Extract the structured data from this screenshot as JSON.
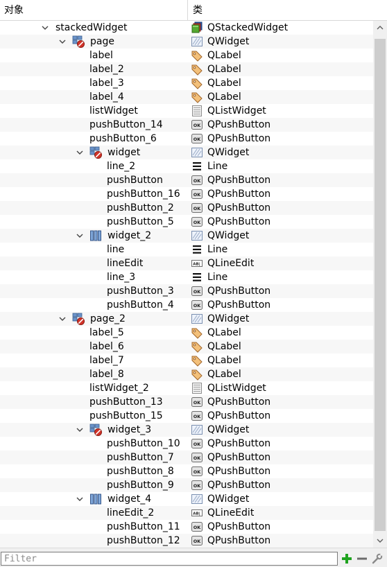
{
  "header": {
    "col_object": "对象",
    "col_class": "类"
  },
  "filter": {
    "placeholder": "Filter",
    "value": ""
  },
  "rows": [
    {
      "name": "stackedWidget",
      "cls": "QStackedWidget",
      "depth": 0,
      "expanded": true,
      "nicon": "none",
      "cicon": "stacked-widget"
    },
    {
      "name": "page",
      "cls": "QWidget",
      "depth": 1,
      "expanded": true,
      "nicon": "grid-layout-broken",
      "cicon": "widget"
    },
    {
      "name": "label",
      "cls": "QLabel",
      "depth": 2,
      "nicon": "none",
      "cicon": "label"
    },
    {
      "name": "label_2",
      "cls": "QLabel",
      "depth": 2,
      "nicon": "none",
      "cicon": "label"
    },
    {
      "name": "label_3",
      "cls": "QLabel",
      "depth": 2,
      "nicon": "none",
      "cicon": "label"
    },
    {
      "name": "label_4",
      "cls": "QLabel",
      "depth": 2,
      "nicon": "none",
      "cicon": "label"
    },
    {
      "name": "listWidget",
      "cls": "QListWidget",
      "depth": 2,
      "nicon": "none",
      "cicon": "list-widget"
    },
    {
      "name": "pushButton_14",
      "cls": "QPushButton",
      "depth": 2,
      "nicon": "none",
      "cicon": "push-button"
    },
    {
      "name": "pushButton_6",
      "cls": "QPushButton",
      "depth": 2,
      "nicon": "none",
      "cicon": "push-button"
    },
    {
      "name": "widget",
      "cls": "QWidget",
      "depth": 2,
      "expanded": true,
      "nicon": "grid-layout-broken",
      "cicon": "widget"
    },
    {
      "name": "line_2",
      "cls": "Line",
      "depth": 3,
      "nicon": "none",
      "cicon": "line"
    },
    {
      "name": "pushButton",
      "cls": "QPushButton",
      "depth": 3,
      "nicon": "none",
      "cicon": "push-button"
    },
    {
      "name": "pushButton_16",
      "cls": "QPushButton",
      "depth": 3,
      "nicon": "none",
      "cicon": "push-button"
    },
    {
      "name": "pushButton_2",
      "cls": "QPushButton",
      "depth": 3,
      "nicon": "none",
      "cicon": "push-button"
    },
    {
      "name": "pushButton_5",
      "cls": "QPushButton",
      "depth": 3,
      "nicon": "none",
      "cicon": "push-button"
    },
    {
      "name": "widget_2",
      "cls": "QWidget",
      "depth": 2,
      "expanded": true,
      "nicon": "horizontal-layout",
      "cicon": "widget"
    },
    {
      "name": "line",
      "cls": "Line",
      "depth": 3,
      "nicon": "none",
      "cicon": "line"
    },
    {
      "name": "lineEdit",
      "cls": "QLineEdit",
      "depth": 3,
      "nicon": "none",
      "cicon": "line-edit"
    },
    {
      "name": "line_3",
      "cls": "Line",
      "depth": 3,
      "nicon": "none",
      "cicon": "line"
    },
    {
      "name": "pushButton_3",
      "cls": "QPushButton",
      "depth": 3,
      "nicon": "none",
      "cicon": "push-button"
    },
    {
      "name": "pushButton_4",
      "cls": "QPushButton",
      "depth": 3,
      "nicon": "none",
      "cicon": "push-button"
    },
    {
      "name": "page_2",
      "cls": "QWidget",
      "depth": 1,
      "expanded": true,
      "nicon": "grid-layout-broken",
      "cicon": "widget"
    },
    {
      "name": "label_5",
      "cls": "QLabel",
      "depth": 2,
      "nicon": "none",
      "cicon": "label"
    },
    {
      "name": "label_6",
      "cls": "QLabel",
      "depth": 2,
      "nicon": "none",
      "cicon": "label"
    },
    {
      "name": "label_7",
      "cls": "QLabel",
      "depth": 2,
      "nicon": "none",
      "cicon": "label"
    },
    {
      "name": "label_8",
      "cls": "QLabel",
      "depth": 2,
      "nicon": "none",
      "cicon": "label"
    },
    {
      "name": "listWidget_2",
      "cls": "QListWidget",
      "depth": 2,
      "nicon": "none",
      "cicon": "list-widget"
    },
    {
      "name": "pushButton_13",
      "cls": "QPushButton",
      "depth": 2,
      "nicon": "none",
      "cicon": "push-button"
    },
    {
      "name": "pushButton_15",
      "cls": "QPushButton",
      "depth": 2,
      "nicon": "none",
      "cicon": "push-button"
    },
    {
      "name": "widget_3",
      "cls": "QWidget",
      "depth": 2,
      "expanded": true,
      "nicon": "grid-layout-broken",
      "cicon": "widget"
    },
    {
      "name": "pushButton_10",
      "cls": "QPushButton",
      "depth": 3,
      "nicon": "none",
      "cicon": "push-button"
    },
    {
      "name": "pushButton_7",
      "cls": "QPushButton",
      "depth": 3,
      "nicon": "none",
      "cicon": "push-button"
    },
    {
      "name": "pushButton_8",
      "cls": "QPushButton",
      "depth": 3,
      "nicon": "none",
      "cicon": "push-button"
    },
    {
      "name": "pushButton_9",
      "cls": "QPushButton",
      "depth": 3,
      "nicon": "none",
      "cicon": "push-button"
    },
    {
      "name": "widget_4",
      "cls": "QWidget",
      "depth": 2,
      "expanded": true,
      "nicon": "horizontal-layout",
      "cicon": "widget"
    },
    {
      "name": "lineEdit_2",
      "cls": "QLineEdit",
      "depth": 3,
      "nicon": "none",
      "cicon": "line-edit"
    },
    {
      "name": "pushButton_11",
      "cls": "QPushButton",
      "depth": 3,
      "nicon": "none",
      "cicon": "push-button"
    },
    {
      "name": "pushButton_12",
      "cls": "QPushButton",
      "depth": 3,
      "nicon": "none",
      "cicon": "push-button"
    }
  ],
  "toolbar": {
    "add_icon": "plus-icon",
    "remove_icon": "minus-icon",
    "config_icon": "wrench-icon"
  },
  "colors": {
    "add_green": "#1fa31f",
    "remove_gray": "#6b6b6b",
    "selection": "#cce8ff"
  }
}
